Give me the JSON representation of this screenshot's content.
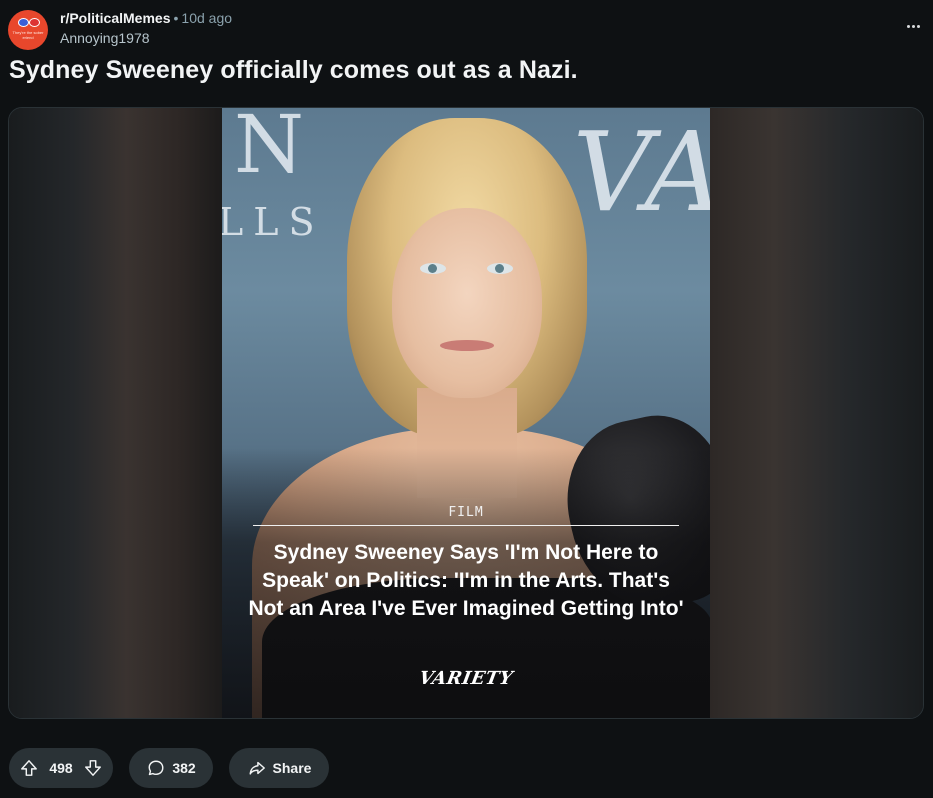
{
  "post": {
    "subreddit": "r/PoliticalMemes",
    "time_separator": "•",
    "time": "10d ago",
    "author": "Annoying1978",
    "avatar_text": "They're the sober eriend",
    "title": "Sydney Sweeney officially comes out as a Nazi."
  },
  "image": {
    "bg_letters": {
      "n": "N",
      "v": "VA",
      "lls": "LLS"
    },
    "category": "FILM",
    "headline": "Sydney Sweeney Says 'I'm Not Here to Speak' on Politics: 'I'm in the Arts. That's Not an Area I've Ever Imagined Getting Into'",
    "brand": "VARIETY"
  },
  "actions": {
    "upvotes": "498",
    "comments": "382",
    "share_label": "Share"
  },
  "icons": {
    "more": "more-horizontal-icon",
    "upvote": "arrow-up-icon",
    "downvote": "arrow-down-icon",
    "comment": "comment-bubble-icon",
    "share": "share-arrow-icon"
  },
  "colors": {
    "background": "#0e1113",
    "pill": "#2a3236",
    "muted_text": "#8ba2ad"
  }
}
